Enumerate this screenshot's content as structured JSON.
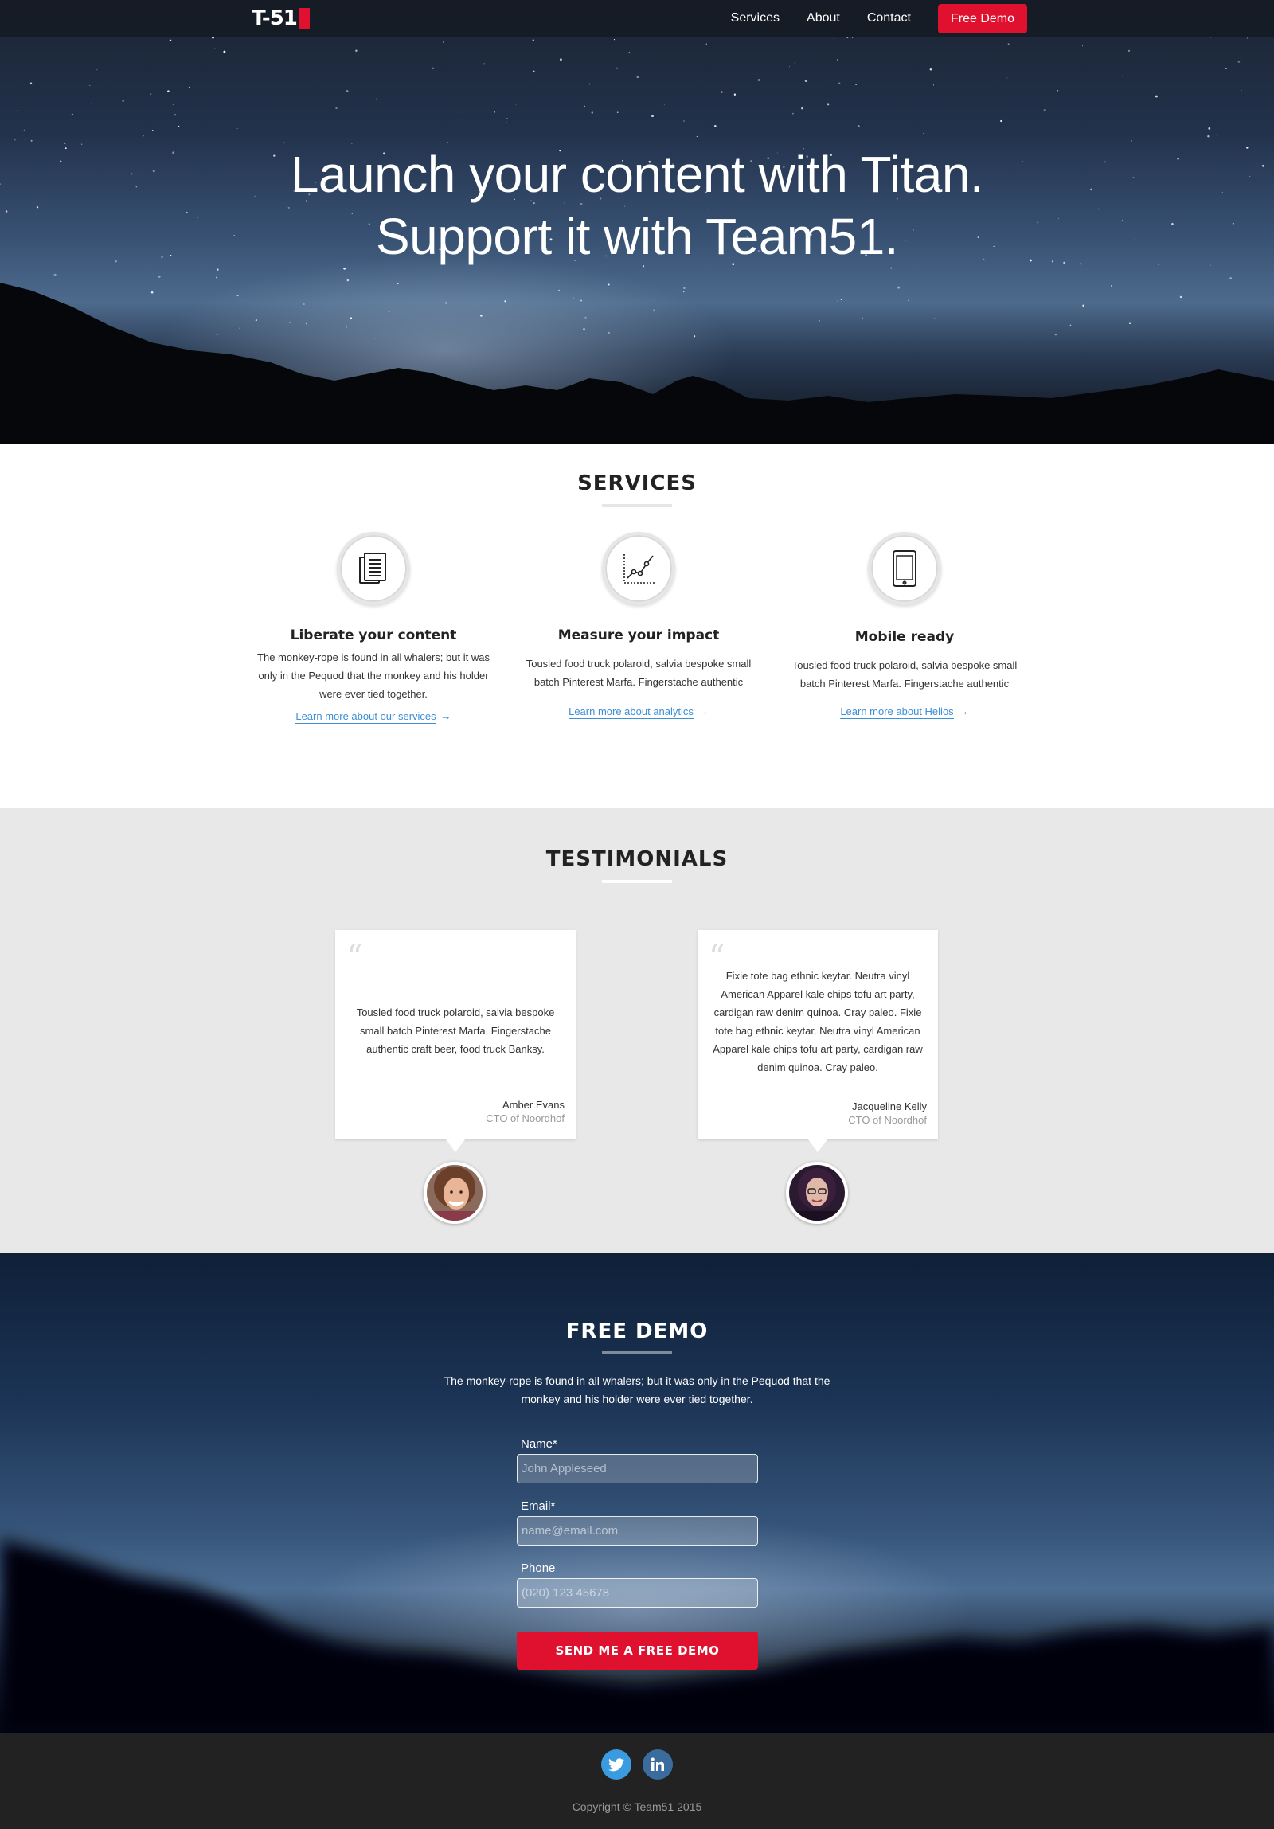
{
  "nav": {
    "logo_text": "T-51",
    "links": [
      "Services",
      "About",
      "Contact"
    ],
    "cta": "Free Demo"
  },
  "hero": {
    "line1": "Launch your content with Titan.",
    "line2": "Support it with Team51."
  },
  "services": {
    "title": "SERVICES",
    "items": [
      {
        "icon": "documents-icon",
        "title": "Liberate your content",
        "text": "The monkey-rope is found in all whalers; but it was only in the Pequod that the monkey and his holder were ever tied together.",
        "link": "Learn more about our services"
      },
      {
        "icon": "chart-icon",
        "title": "Measure your impact",
        "text": "Tousled food truck polaroid, salvia bespoke small batch Pinterest Marfa. Fingerstache authentic",
        "link": "Learn more about analytics"
      },
      {
        "icon": "tablet-icon",
        "title": "Mobile ready",
        "text": "Tousled food truck polaroid, salvia bespoke small batch Pinterest Marfa. Fingerstache authentic",
        "link": "Learn more about Helios"
      }
    ]
  },
  "testimonials": {
    "title": "TESTIMONIALS",
    "items": [
      {
        "quote": "Tousled food truck polaroid, salvia bespoke small batch Pinterest Marfa. Fingerstache authentic craft beer, food truck Banksy.",
        "name": "Amber Evans",
        "role": "CTO of Noordhof"
      },
      {
        "quote": "Fixie tote bag ethnic keytar. Neutra vinyl American Apparel kale chips tofu art party, cardigan raw denim quinoa. Cray paleo. Fixie tote bag ethnic keytar. Neutra vinyl American Apparel kale chips tofu art party, cardigan raw denim quinoa. Cray paleo.",
        "name": "Jacqueline Kelly",
        "role": "CTO of Noordhof"
      }
    ]
  },
  "demo": {
    "title": "FREE DEMO",
    "subtitle": "The monkey-rope is found in all whalers; but it was only in the Pequod that the monkey and his holder were ever tied together.",
    "fields": [
      {
        "label": "Name*",
        "placeholder": "John Appleseed"
      },
      {
        "label": "Email*",
        "placeholder": "name@email.com"
      },
      {
        "label": "Phone",
        "placeholder": "(020) 123 45678"
      }
    ],
    "submit": "SEND ME A FREE DEMO"
  },
  "footer": {
    "social": [
      "twitter-icon",
      "linkedin-icon"
    ],
    "copyright": "Copyright © Team51 2015"
  },
  "colors": {
    "accent_red": "#e0102f",
    "link_blue": "#3d8fd6",
    "nav_bg": "#161b24",
    "footer_bg": "#222222",
    "testimonials_bg": "#e8e8e8",
    "twitter_blue": "#3b9be0",
    "linkedin_blue": "#3a6d9e"
  }
}
